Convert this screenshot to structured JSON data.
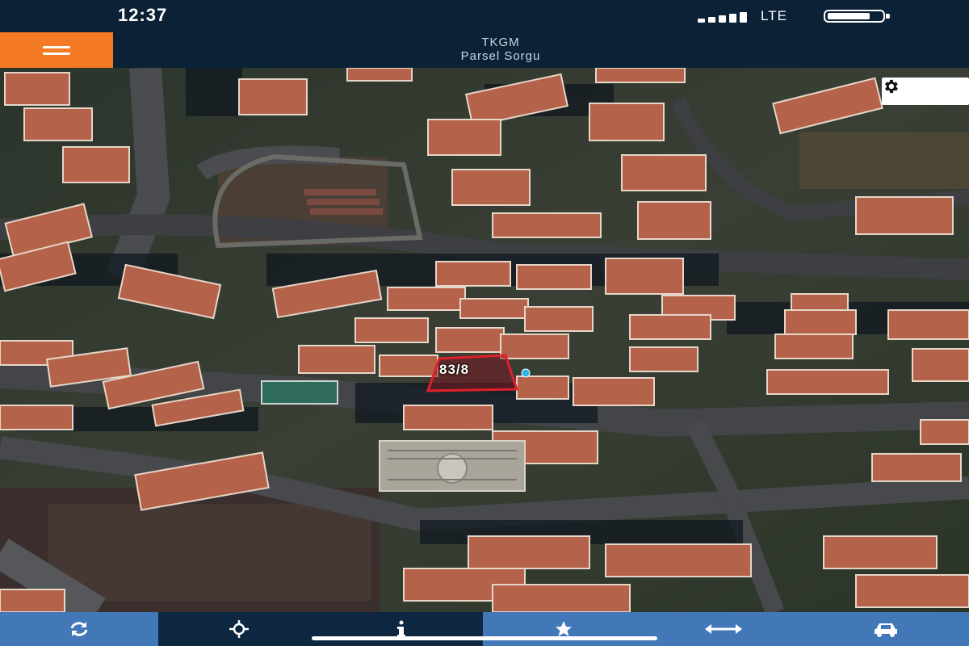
{
  "status_bar": {
    "time": "12:37",
    "network": "LTE",
    "battery_level": 0.75,
    "signal_bars": 4
  },
  "header": {
    "title_line1": "TKGM",
    "title_line2": "Parsel Sorgu",
    "menu_icon": "hamburger-icon"
  },
  "map": {
    "parcel_label": "83/8",
    "settings_icon": "gear-icon",
    "colors": {
      "roof": "#b5624a",
      "road": "#3b3d40",
      "shadow": "#101820",
      "vegetation": "#2e3e26",
      "parcel_outline": "#e0202a",
      "marker": "#2fb6e8"
    }
  },
  "toolbar": {
    "items": [
      {
        "icon": "refresh-icon"
      },
      {
        "icon": "location-crosshair-icon"
      },
      {
        "icon": "info-icon"
      },
      {
        "icon": "star-icon"
      },
      {
        "icon": "measure-icon"
      },
      {
        "icon": "car-icon"
      }
    ]
  }
}
